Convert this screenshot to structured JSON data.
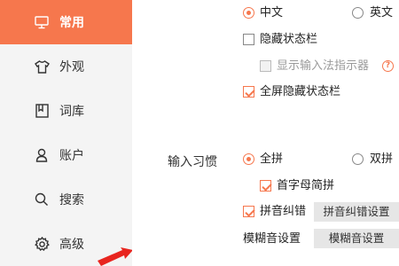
{
  "sidebar": {
    "items": [
      {
        "label": "常用",
        "icon": "monitor-icon",
        "active": true
      },
      {
        "label": "外观",
        "icon": "shirt-icon",
        "active": false
      },
      {
        "label": "词库",
        "icon": "bookmark-book-icon",
        "active": false
      },
      {
        "label": "账户",
        "icon": "person-icon",
        "active": false
      },
      {
        "label": "搜索",
        "icon": "search-icon",
        "active": false
      },
      {
        "label": "高级",
        "icon": "gear-icon",
        "active": false
      }
    ]
  },
  "main": {
    "language": {
      "options": [
        "中文",
        "英文"
      ],
      "selected": "中文"
    },
    "status_bar": {
      "hide_label": "隐藏状态栏",
      "hide_checked": false,
      "show_indicator_label": "显示输入法指示器",
      "show_indicator_enabled": false,
      "fullscreen_hide_label": "全屏隐藏状态栏",
      "fullscreen_hide_checked": true
    },
    "input_habit": {
      "section_label": "输入习惯",
      "options": [
        "全拼",
        "双拼"
      ],
      "selected": "全拼",
      "initial_abbrev_label": "首字母简拼",
      "initial_abbrev_checked": true,
      "pinyin_correction_label": "拼音纠错",
      "pinyin_correction_checked": true,
      "pinyin_correction_button": "拼音纠错设置",
      "fuzzy_label": "模糊音设置",
      "fuzzy_button": "模糊音设置"
    }
  },
  "colors": {
    "accent": "#f6774d",
    "sidebar_bg": "#f4f4f4",
    "button_bg": "#e6e6e6"
  }
}
